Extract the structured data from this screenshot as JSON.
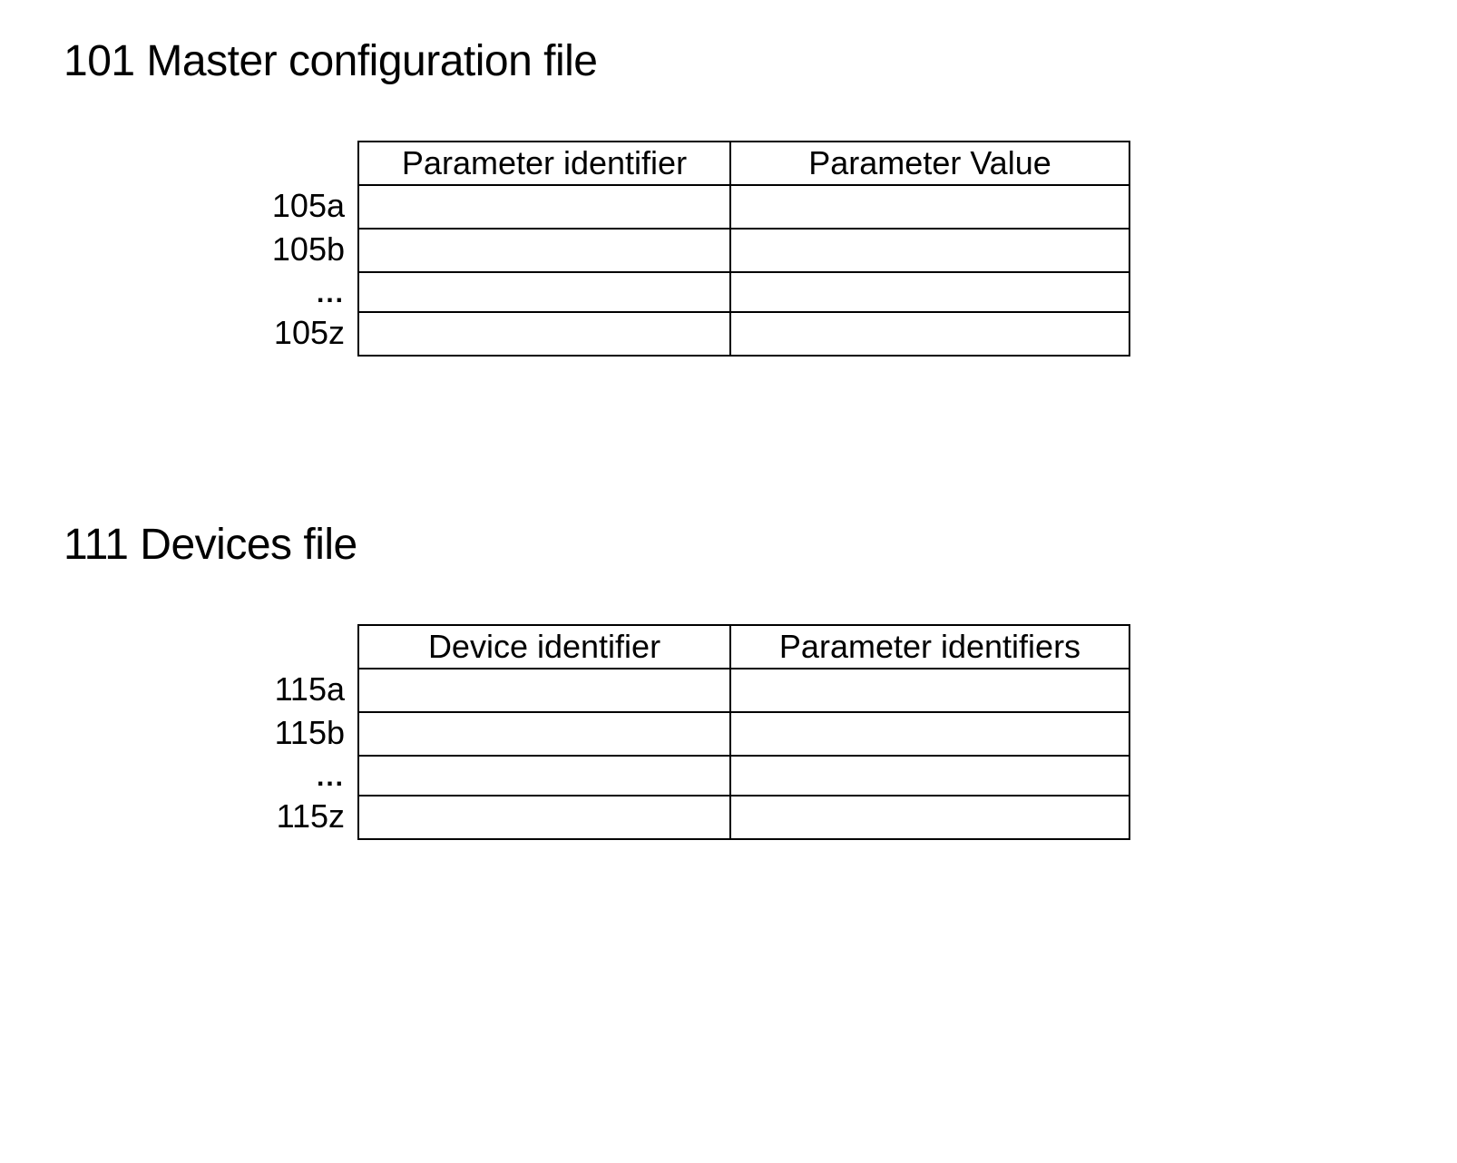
{
  "section1": {
    "title": "101 Master configuration file",
    "header1": "Parameter identifier",
    "header2": "Parameter Value",
    "row_labels": [
      "105a",
      "105b",
      "...",
      "105z"
    ]
  },
  "section2": {
    "title": "111 Devices file",
    "header1": "Device identifier",
    "header2": "Parameter identifiers",
    "row_labels": [
      "115a",
      "115b",
      "...",
      "115z"
    ]
  }
}
